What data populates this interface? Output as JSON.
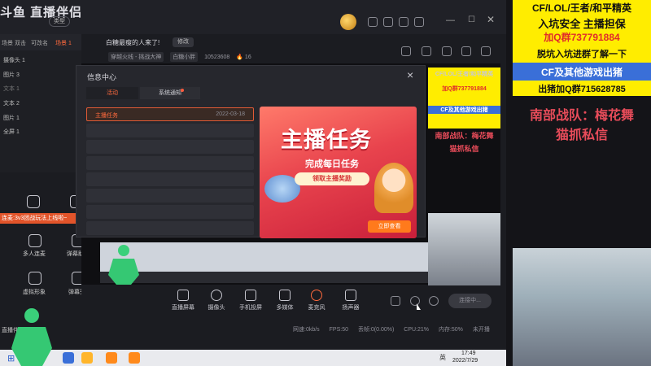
{
  "app": {
    "logo": "斗鱼 直播伴侣",
    "type_button": "类型"
  },
  "tabs": {
    "t1": "场景",
    "t2": "双击",
    "t3": "可改名",
    "t4": "场景 1"
  },
  "scenes": {
    "s1": "摄像头 1",
    "s2": "图片 3",
    "s3": "文本 1",
    "s4": "文本 2",
    "s5": "图片 1",
    "s6": "全屏 1"
  },
  "side": {
    "banner": "连麦:3v3团战玩法上线啦~",
    "multi_connect": "多人连麦",
    "gift_helper": "弹幕助手",
    "virtual_image": "虚拟形象",
    "danmu": "弹幕秀",
    "live_partner": "直播伴侣"
  },
  "header": {
    "welcome": "白糖最瘦的人来了!",
    "edit": "修改",
    "category": "穿越火线 - 挑战大神",
    "user": "白糖小胖",
    "room_id": "10523608",
    "hot": "16"
  },
  "modal": {
    "title": "信息中心",
    "close": "×",
    "tab_activity": "活动",
    "tab_system": "系统通知",
    "item_title": "主播任务",
    "item_date": "2022-03-18",
    "banner_title": "主播任务",
    "banner_sub": "完成每日任务",
    "banner_pill": "领取主播奖励",
    "banner_btn": "立即查看"
  },
  "toolbar": {
    "screen": "直播屏幕",
    "camera": "摄像头",
    "phone": "手机投屏",
    "media": "多媒体",
    "mic": "麦克风",
    "speaker": "扬声器",
    "live": "连接中..."
  },
  "status": {
    "net": "网速:0kb/s",
    "fps": "FPS:50",
    "drop": "丢帧:0(0.00%)",
    "cpu": "CPU:21%",
    "mem": "内存:50%",
    "rec": "未开播"
  },
  "taskbar": {
    "time": "17:49",
    "date": "2022/7/29",
    "lang": "英"
  },
  "overlay": {
    "ad1": "CF/LOL/王者/和平精英",
    "ad2": "入坑安全 主播担保",
    "ad3": "加Q群737791884",
    "ad4": "脱坑入坑进群了解一下",
    "ad5": "CF及其他游戏出猪",
    "ad6": "出猪加Q群715628785",
    "team1": "南部战队：梅花舞",
    "team2": "猫抓私信"
  },
  "colors": {
    "accent": "#ff6a3d",
    "ad_yellow": "#ffed00",
    "team_red": "#e84c5a"
  }
}
